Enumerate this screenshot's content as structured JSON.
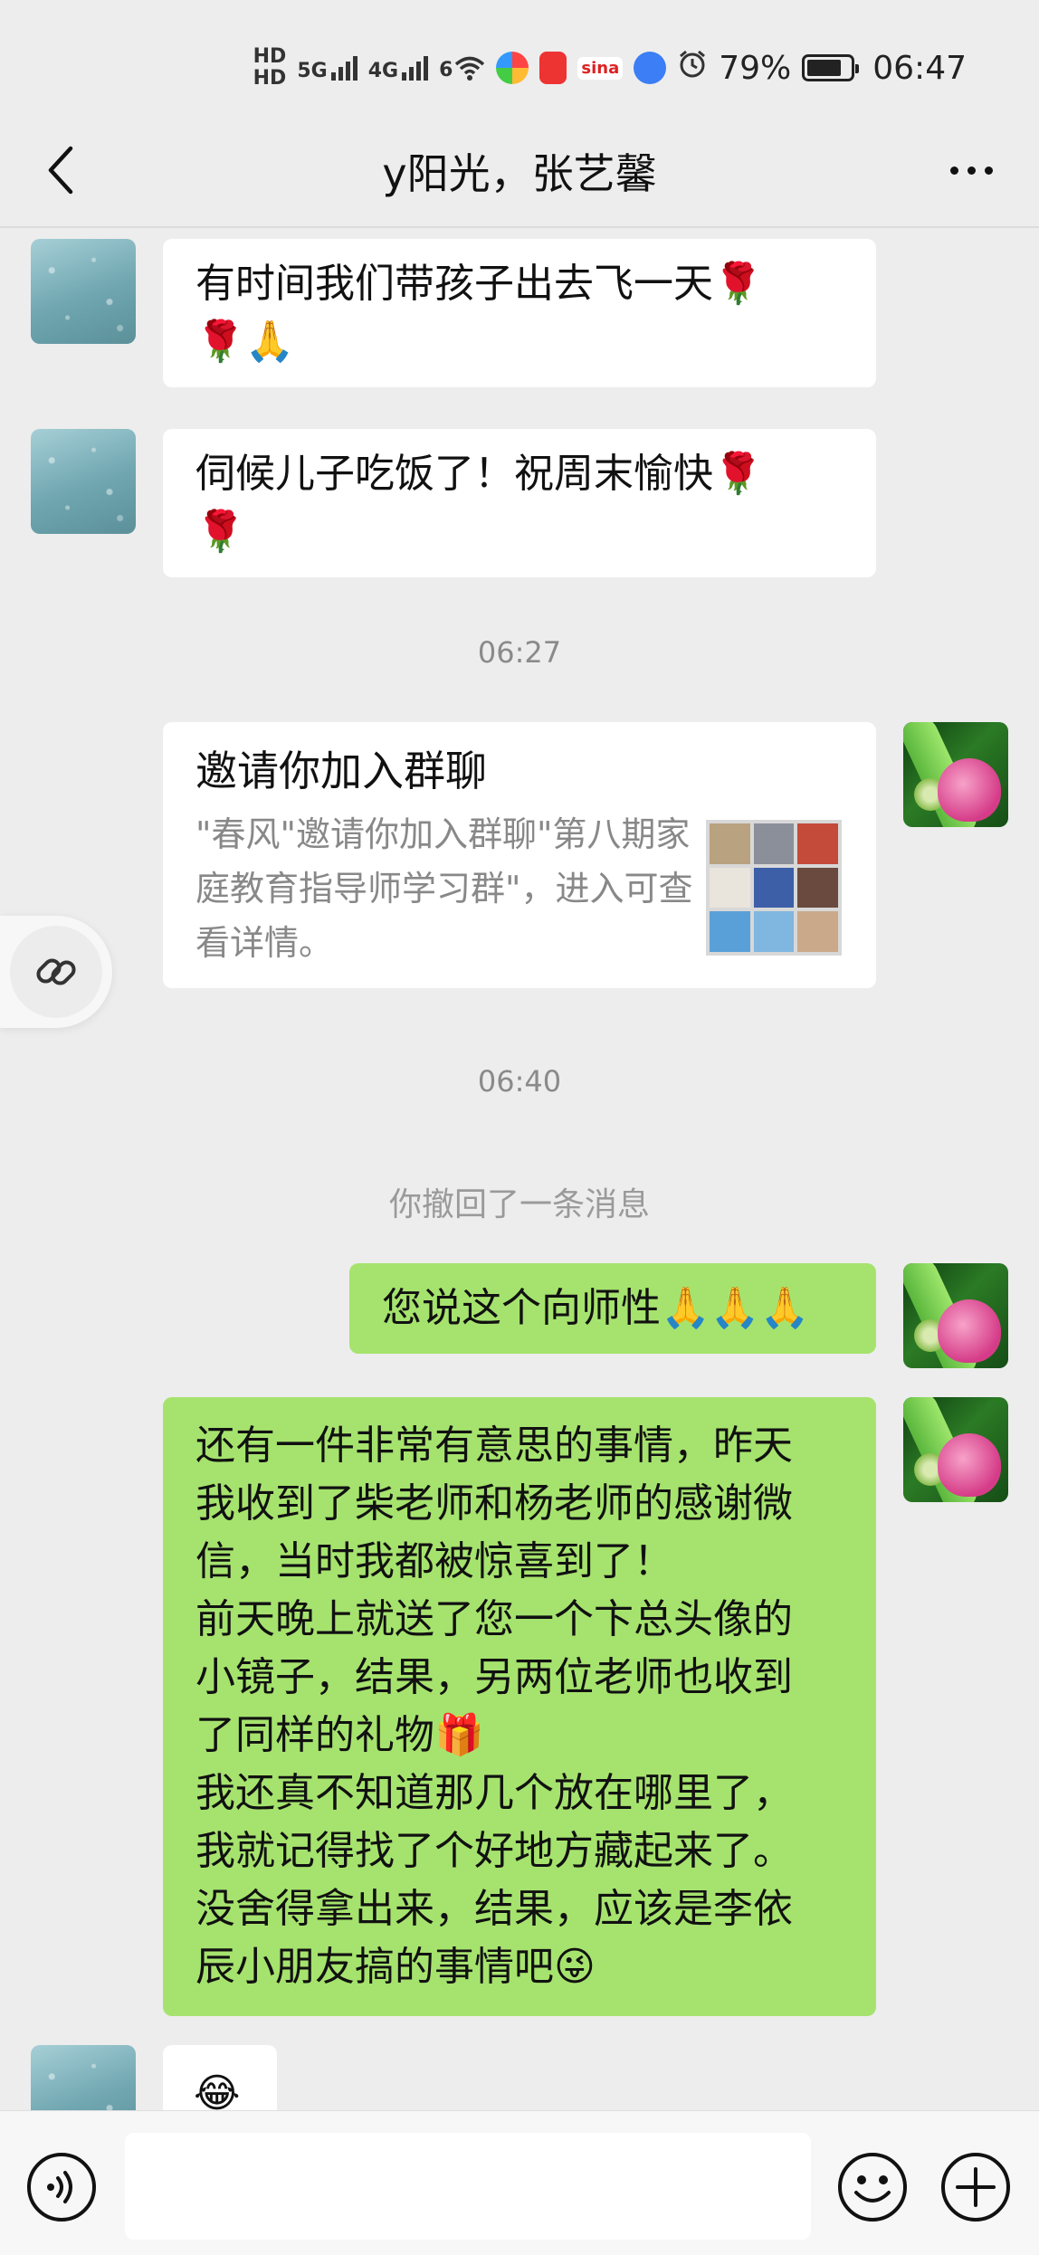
{
  "status_bar": {
    "hd1": "HD",
    "hd2": "HD",
    "net1": "5G",
    "net2": "4G",
    "net3": "6",
    "app_sina": "sina",
    "battery_level": 79,
    "battery_text": "79%",
    "time": "06:47"
  },
  "header": {
    "title": "y阳光，张艺馨"
  },
  "messages": {
    "m1": {
      "text": "有时间我们带孩子出去飞一天🌹\n🌹🙏"
    },
    "m2": {
      "text": "伺候儿子吃饭了！祝周末愉快🌹\n🌹"
    },
    "ts1": "06:27",
    "invite": {
      "title": "邀请你加入群聊",
      "desc": "\"春风\"邀请你加入群聊\"第八期家庭教育指导师学习群\"，进入可查看详情。"
    },
    "ts2": "06:40",
    "recall": "你撤回了一条消息",
    "m3": {
      "text": "您说这个向师性🙏🙏🙏"
    },
    "m4": {
      "text": "还有一件非常有意思的事情，昨天\n我收到了柴老师和杨老师的感谢微\n信，当时我都被惊喜到了！\n前天晚上就送了您一个卞总头像的\n小镜子，结果，另两位老师也收到\n了同样的礼物🎁\n我还真不知道那几个放在哪里了，\n我就记得找了个好地方藏起来了。\n没舍得拿出来，结果，应该是李依\n辰小朋友搞的事情吧😜"
    },
    "m5": {
      "text": "😂"
    }
  },
  "colors": {
    "chat_bg": "#ededed",
    "bubble_self": "#a6e36e",
    "bubble_other": "#ffffff"
  },
  "icons": {
    "back": "chevron-left-icon",
    "more": "more-dots-icon",
    "link": "link-icon",
    "voice": "voice-icon",
    "emoji": "emoji-icon",
    "plus": "plus-icon"
  }
}
